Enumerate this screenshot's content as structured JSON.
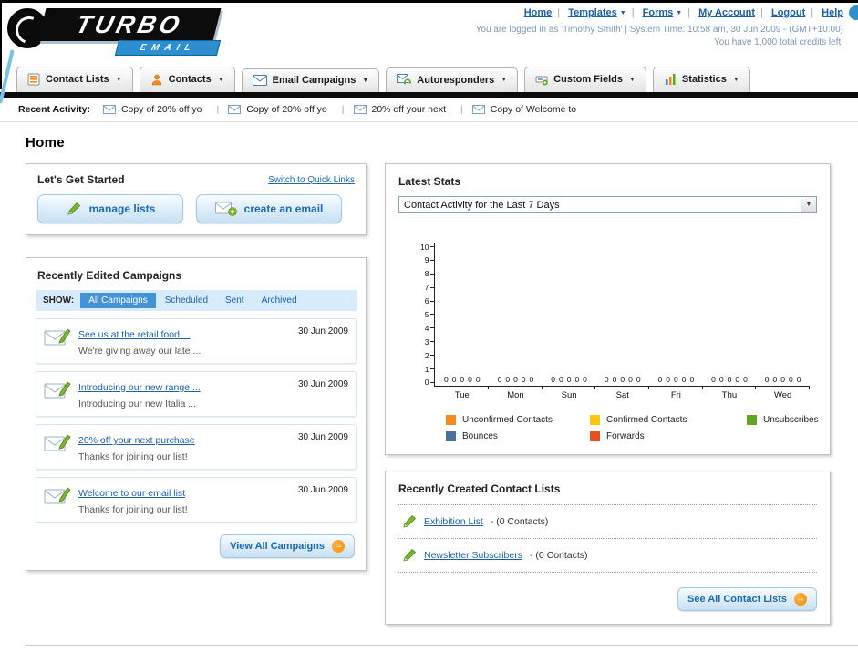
{
  "icons": {
    "arrow_right": "→",
    "caret_down": "▼",
    "select_arrow": "▼"
  },
  "header": {
    "logo": {
      "title": "TURBO",
      "subtitle": "EMAIL"
    },
    "nav_links": [
      {
        "label": "Home",
        "has_dropdown": false
      },
      {
        "label": "Templates",
        "has_dropdown": true
      },
      {
        "label": "Forms",
        "has_dropdown": true
      },
      {
        "label": "My Account",
        "has_dropdown": false
      },
      {
        "label": "Logout",
        "has_dropdown": false
      },
      {
        "label": "Help",
        "has_dropdown": false
      }
    ],
    "login_status": "You are logged in as 'Timothy Smith' | System Time: 10:58 am, 30 Jun 2009 - (GMT+10:00)",
    "credits_note": "You have 1,000 total credits left."
  },
  "nav_tabs": [
    {
      "label": "Contact Lists"
    },
    {
      "label": "Contacts"
    },
    {
      "label": "Email Campaigns"
    },
    {
      "label": "Autoresponders"
    },
    {
      "label": "Custom Fields"
    },
    {
      "label": "Statistics"
    }
  ],
  "recent_activity": {
    "label": "Recent Activity:",
    "items": [
      "Copy of 20% off yo",
      "Copy of 20% off yo",
      "20% off your next",
      "Copy of Welcome to"
    ]
  },
  "page_title": "Home",
  "get_started": {
    "title": "Let's Get Started",
    "switch_link": "Switch to Quick Links",
    "buttons": [
      {
        "label": "manage lists"
      },
      {
        "label": "create an email"
      }
    ]
  },
  "campaigns": {
    "title": "Recently Edited Campaigns",
    "show_label": "SHOW:",
    "filters": [
      "All Campaigns",
      "Scheduled",
      "Sent",
      "Archived"
    ],
    "active_filter": "All Campaigns",
    "items": [
      {
        "title": "See us at the retail food ...",
        "subtitle": "We're giving away our late ...",
        "date": "30 Jun 2009"
      },
      {
        "title": "Introducing our new range ...",
        "subtitle": "Introducing our new Italia ...",
        "date": "30 Jun 2009"
      },
      {
        "title": "20% off your next purchase",
        "subtitle": "Thanks for joining our list!",
        "date": "30 Jun 2009"
      },
      {
        "title": "Welcome to our email list",
        "subtitle": "Thanks for joining our list!",
        "date": "30 Jun 2009"
      }
    ],
    "view_all_label": "View All Campaigns"
  },
  "stats": {
    "title": "Latest Stats",
    "dropdown_value": "Contact Activity for the Last 7 Days",
    "chart_data": {
      "type": "bar",
      "title": "Contact Activity for the Last 7 Days",
      "categories": [
        "Tue",
        "Mon",
        "Sun",
        "Sat",
        "Fri",
        "Thu",
        "Wed"
      ],
      "series": [
        {
          "name": "Unconfirmed Contacts",
          "color": "#f6891f",
          "values": [
            0,
            0,
            0,
            0,
            0,
            0,
            0
          ]
        },
        {
          "name": "Confirmed Contacts",
          "color": "#fdc50b",
          "values": [
            0,
            0,
            0,
            0,
            0,
            0,
            0
          ]
        },
        {
          "name": "Unsubscribes",
          "color": "#61a622",
          "values": [
            0,
            0,
            0,
            0,
            0,
            0,
            0
          ]
        },
        {
          "name": "Bounces",
          "color": "#4a6e9e",
          "values": [
            0,
            0,
            0,
            0,
            0,
            0,
            0
          ]
        },
        {
          "name": "Forwards",
          "color": "#e8501f",
          "values": [
            0,
            0,
            0,
            0,
            0,
            0,
            0
          ]
        }
      ],
      "ylim": [
        0,
        10
      ],
      "yticks": [
        0,
        1,
        2,
        3,
        4,
        5,
        6,
        7,
        8,
        9,
        10
      ],
      "grid": false,
      "legend_position": "bottom"
    },
    "legend": [
      {
        "label": "Unconfirmed Contacts",
        "color": "#f6891f"
      },
      {
        "label": "Confirmed Contacts",
        "color": "#fdc50b"
      },
      {
        "label": "Unsubscribes",
        "color": "#61a622"
      },
      {
        "label": "Bounces",
        "color": "#4a6e9e"
      },
      {
        "label": "Forwards",
        "color": "#e8501f"
      }
    ]
  },
  "contact_lists": {
    "title": "Recently Created Contact Lists",
    "items": [
      {
        "name": "Exhibition List",
        "detail": "- (0 Contacts)"
      },
      {
        "name": "Newsletter Subscribers",
        "detail": "- (0 Contacts)"
      }
    ],
    "see_all_label": "See All Contact Lists"
  },
  "colors": {
    "link": "#1b61ae",
    "accent_orange": "#f38b00",
    "nav_bar": "#0b0b0b"
  }
}
